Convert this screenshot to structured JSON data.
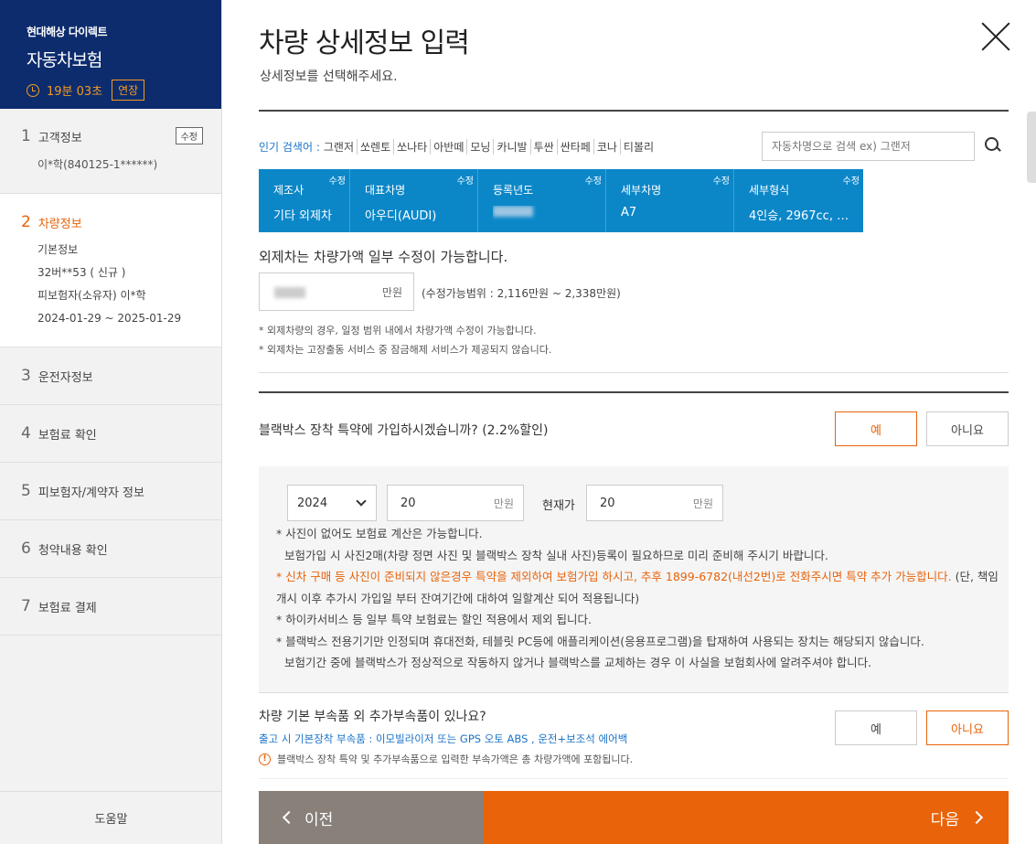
{
  "sidebar": {
    "company": "현대해상 다이렉트",
    "product": "자동차보험",
    "timer": "19분 03초",
    "extend_label": "연장",
    "steps": [
      {
        "num": "1",
        "label": "고객정보",
        "edit": "수정",
        "sub": "이*학(840125-1******)"
      },
      {
        "num": "2",
        "label": "차량정보",
        "info": [
          "기본정보",
          "32버**53 ( 신규 )",
          "피보험자(소유자) 이*학",
          "2024-01-29 ~ 2025-01-29"
        ]
      },
      {
        "num": "3",
        "label": "운전자정보"
      },
      {
        "num": "4",
        "label": "보험료 확인"
      },
      {
        "num": "5",
        "label": "피보험자/계약자 정보"
      },
      {
        "num": "6",
        "label": "청약내용 확인"
      },
      {
        "num": "7",
        "label": "보험료 결제"
      }
    ],
    "help": "도움말"
  },
  "header": {
    "title": "차량 상세정보 입력",
    "subtitle": "상세정보를 선택해주세요."
  },
  "popular": {
    "label": "인기 검색어 :",
    "keywords": [
      "그랜저",
      "쏘렌토",
      "쏘나타",
      "아반떼",
      "모닝",
      "카니발",
      "투싼",
      "싼타페",
      "코나",
      "티볼리"
    ]
  },
  "search": {
    "placeholder": "자동차명으로 검색 ex) 그랜저"
  },
  "car": {
    "edit": "수정",
    "cells": [
      {
        "head": "제조사",
        "value": "기타 외제차"
      },
      {
        "head": "대표차명",
        "value": "아우디(AUDI)"
      },
      {
        "head": "등록년도",
        "value": ""
      },
      {
        "head": "세부차명",
        "value": "A7"
      },
      {
        "head": "세부형식",
        "value": "4인승, 2967cc, …"
      }
    ]
  },
  "price": {
    "notice": "외제차는 차량가액 일부 수정이 가능합니다.",
    "unit": "만원",
    "range": "(수정가능범위 : 2,116만원 ~ 2,338만원)",
    "notes": [
      "* 외제차량의 경우, 일정 범위 내에서 차량가액 수정이 가능합니다.",
      "* 외제차는 고장출동 서비스 중 잠금해제 서비스가 제공되지 않습니다."
    ]
  },
  "blackbox": {
    "question": "블랙박스 장착 특약에 가입하시겠습니까? (2.2%할인)",
    "yes": "예",
    "no": "아니요",
    "year": "2024",
    "price1": "20",
    "unit": "만원",
    "current_label": "현재가",
    "price2": "20",
    "note1": "* 사진이 없어도 보험료 계산은 가능합니다.",
    "note1b": "보험가입 시 사진2매(차량 정면 사진 및 블랙박스 장착 실내 사진)등록이 필요하므로 미리 준비해 주시기 바랍니다.",
    "note2_orange": "* 신차 구매 등 사진이 준비되지 않은경우 특약을 제외하여 보험가입 하시고, 추후 1899-6782(내선2번)로 전화주시면 특약 추가 가능합니다.",
    "note2_rest": "(단, 책임개시 이후 추가시 가입일 부터 잔여기간에 대하여 일할계산 되어 적용됩니다)",
    "note3": "* 하이카서비스 등 일부 특약 보험료는 할인 적용에서 제외 됩니다.",
    "note4": "* 블랙박스 전용기기만 인정되며 휴대전화, 테블릿 PC등에 애플리케이션(응용프로그램)을 탑재하여 사용되는 장치는 해당되지 않습니다.",
    "note4b": "보험기간 중에 블랙박스가 정상적으로 작동하지 않거나 블랙박스를 교체하는 경우 이 사실을 보험회사에 알려주셔야 합니다."
  },
  "accessory": {
    "question": "차량 기본 부속품 외 추가부속품이 있나요?",
    "basic": "출고 시 기본장착 부속품 : 이모빌라이저 또는 GPS 오토 ABS , 운전+보조석 에어백",
    "warning": "블랙박스 장착 특약 및 추가부속품으로 입력한 부속가액은 총 차량가액에 포함됩니다.",
    "yes": "예",
    "no": "아니요"
  },
  "nav": {
    "prev": "이전",
    "next": "다음"
  },
  "colors": {
    "brand": "#0d2c6d",
    "accent": "#e8630a",
    "table": "#0b87c8"
  }
}
